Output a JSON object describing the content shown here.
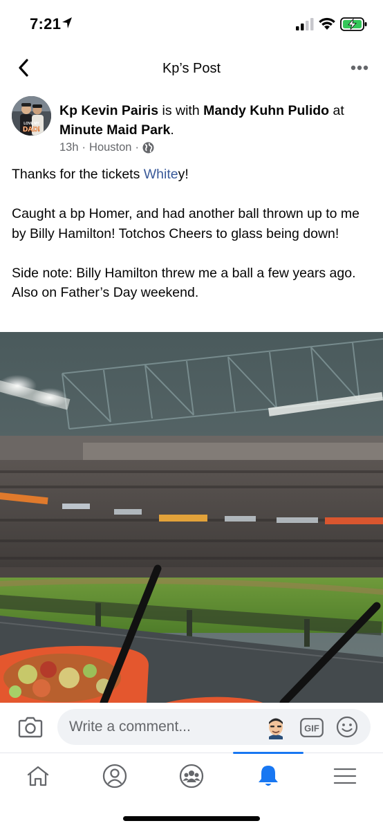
{
  "status": {
    "time": "7:21",
    "icons": [
      "location-arrow-icon",
      "cellular-signal-icon",
      "wifi-icon",
      "battery-charging-icon"
    ]
  },
  "nav": {
    "title": "Kp’s Post",
    "back_icon": "chevron-left-icon",
    "more_icon": "more-horizontal-icon"
  },
  "post": {
    "author": "Kp Kevin Pairis",
    "with_text": "is with",
    "tagged": "Mandy Kuhn Pulido",
    "at_text": "at",
    "place": "Minute Maid Park",
    "period": ".",
    "avatar_caption": "LOVE MY DAD!",
    "time": "13h",
    "location": "Houston",
    "sep": "·",
    "privacy_icon": "globe-icon",
    "body": {
      "line1_prefix": "Thanks for the tickets ",
      "line1_mention": "White",
      "line1_suffix": "y!",
      "para2": "Caught a bp Homer, and had another ball thrown up to me by Billy Hamilton! Totchos Cheers to glass being down!",
      "para3": "Side note: Billy Hamilton threw me a ball a few years ago. Also on Father’s Day weekend."
    },
    "photo_icon": "stadium-photo"
  },
  "comment": {
    "placeholder": "Write a comment...",
    "camera_icon": "camera-icon",
    "avatar_icon": "avatar-sticker-icon",
    "gif_label": "GIF",
    "emoji_icon": "smiley-icon"
  },
  "tabs": [
    {
      "name": "home",
      "icon": "home-icon",
      "active": false
    },
    {
      "name": "profile",
      "icon": "profile-icon",
      "active": false
    },
    {
      "name": "groups",
      "icon": "groups-icon",
      "active": false
    },
    {
      "name": "notifications",
      "icon": "bell-icon",
      "active": true
    },
    {
      "name": "menu",
      "icon": "hamburger-menu-icon",
      "active": false
    }
  ],
  "colors": {
    "accent": "#1877f2",
    "mention": "#385898",
    "meta": "#65676b",
    "icon": "#65676b",
    "battery": "#34c759"
  }
}
